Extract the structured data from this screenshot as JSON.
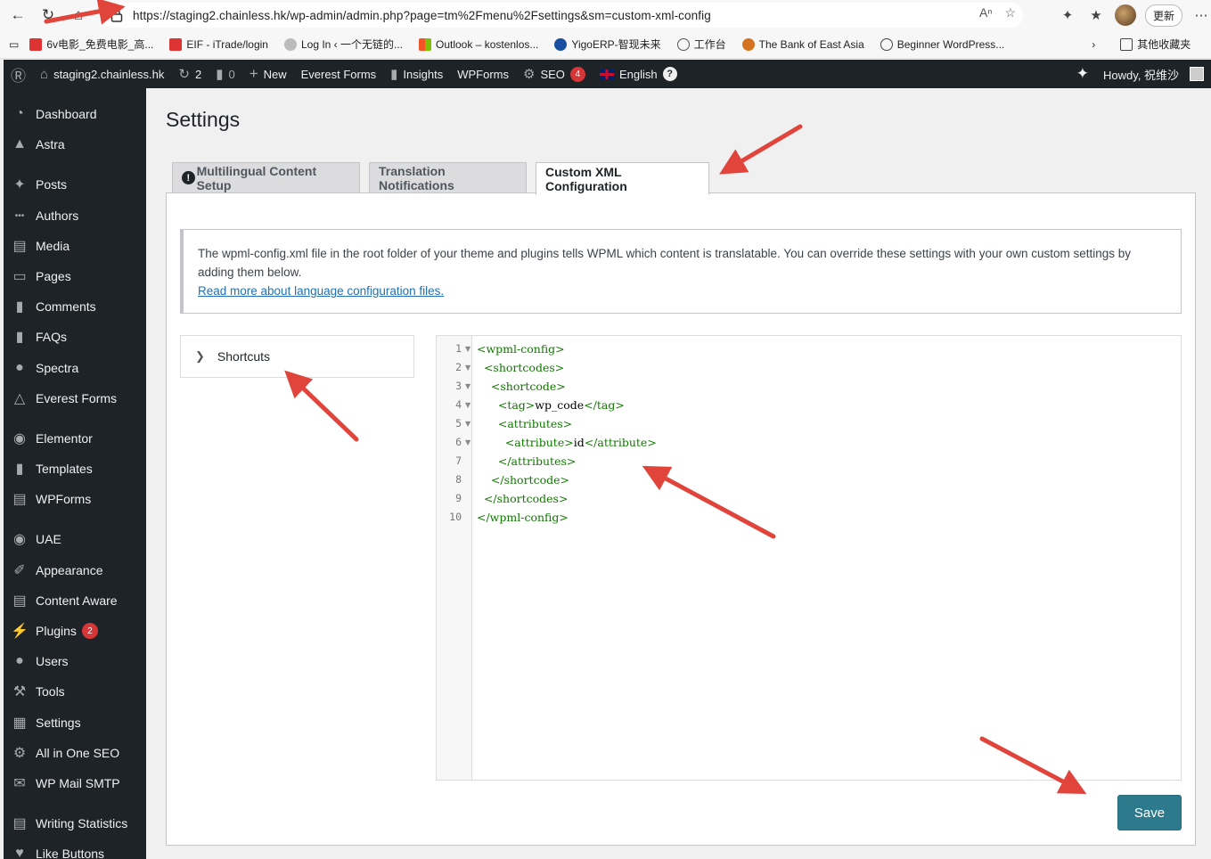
{
  "browser": {
    "url": "https://staging2.chainless.hk/wp-admin/admin.php?page=tm%2Fmenu%2Fsettings&sm=custom-xml-config",
    "update_label": "更新",
    "bookmarks": [
      {
        "label": "6v电影_免费电影_高...",
        "icon": "6v-icon",
        "color": "#d33"
      },
      {
        "label": "EIF - iTrade/login",
        "icon": "eif-icon",
        "color": "#d33"
      },
      {
        "label": "Log In ‹ 一个无链的...",
        "icon": "moon-icon",
        "color": "#888"
      },
      {
        "label": "Outlook – kostenlos...",
        "icon": "microsoft-icon",
        "color": "#f35325"
      },
      {
        "label": "YigoERP-智现未来",
        "icon": "yigo-icon",
        "color": "#1a4fa0"
      },
      {
        "label": "工作台",
        "icon": "globe-icon",
        "color": "#555"
      },
      {
        "label": "The Bank of East Asia",
        "icon": "bea-icon",
        "color": "#d4721e"
      },
      {
        "label": "Beginner WordPress...",
        "icon": "wordpress-icon",
        "color": "#444"
      }
    ],
    "other_bookmarks": "其他收藏夹"
  },
  "adminbar": {
    "site": "staging2.chainless.hk",
    "updates": "2",
    "comments": "0",
    "new": "New",
    "everest_forms": "Everest Forms",
    "insights": "Insights",
    "wpforms": "WPForms",
    "seo": "SEO",
    "seo_count": "4",
    "language": "English",
    "howdy": "Howdy, 祝维沙"
  },
  "sidebar": {
    "items": [
      {
        "label": "Dashboard",
        "icon": "dashboard-icon"
      },
      {
        "label": "Astra",
        "icon": "astra-icon"
      },
      {
        "label": "Posts",
        "icon": "pin-icon"
      },
      {
        "label": "Authors",
        "icon": "dots-icon"
      },
      {
        "label": "Media",
        "icon": "media-icon"
      },
      {
        "label": "Pages",
        "icon": "pages-icon"
      },
      {
        "label": "Comments",
        "icon": "comment-icon"
      },
      {
        "label": "FAQs",
        "icon": "faq-icon"
      },
      {
        "label": "Spectra",
        "icon": "spectra-icon"
      },
      {
        "label": "Everest Forms",
        "icon": "everest-icon"
      },
      {
        "label": "Elementor",
        "icon": "elementor-icon"
      },
      {
        "label": "Templates",
        "icon": "folder-icon"
      },
      {
        "label": "WPForms",
        "icon": "wpforms-icon"
      },
      {
        "label": "UAE",
        "icon": "uae-icon"
      },
      {
        "label": "Appearance",
        "icon": "brush-icon"
      },
      {
        "label": "Content Aware",
        "icon": "content-icon"
      },
      {
        "label": "Plugins",
        "icon": "plug-icon",
        "badge": "2"
      },
      {
        "label": "Users",
        "icon": "user-icon"
      },
      {
        "label": "Tools",
        "icon": "wrench-icon"
      },
      {
        "label": "Settings",
        "icon": "settings-icon"
      },
      {
        "label": "All in One SEO",
        "icon": "seo-icon"
      },
      {
        "label": "WP Mail SMTP",
        "icon": "mail-icon"
      },
      {
        "label": "Writing Statistics",
        "icon": "stats-icon"
      },
      {
        "label": "Like Buttons",
        "icon": "heart-icon"
      }
    ]
  },
  "main": {
    "title": "Settings",
    "tabs": [
      {
        "label": "Multilingual Content Setup"
      },
      {
        "label": "Translation Notifications"
      },
      {
        "label": "Custom XML Configuration"
      }
    ],
    "notice_text": "The wpml-config.xml file in the root folder of your theme and plugins tells WPML which content is translatable. You can override these settings with your own custom settings by adding them below.",
    "notice_link": "Read more about language configuration files.",
    "accordion_label": "Shortcuts",
    "code_lines": [
      {
        "num": "1",
        "fold": true,
        "indent": "",
        "tag": "<wpml-config>",
        "text": ""
      },
      {
        "num": "2",
        "fold": true,
        "indent": "  ",
        "tag": "<shortcodes>",
        "text": ""
      },
      {
        "num": "3",
        "fold": true,
        "indent": "    ",
        "tag": "<shortcode>",
        "text": ""
      },
      {
        "num": "4",
        "fold": true,
        "indent": "      ",
        "tag": "<tag>",
        "text": "wp_code",
        "close": "</tag>"
      },
      {
        "num": "5",
        "fold": true,
        "indent": "      ",
        "tag": "<attributes>",
        "text": ""
      },
      {
        "num": "6",
        "fold": true,
        "indent": "        ",
        "tag": "<attribute>",
        "text": "id",
        "close": "</attribute>"
      },
      {
        "num": "7",
        "fold": false,
        "indent": "      ",
        "tag": "</attributes>",
        "text": ""
      },
      {
        "num": "8",
        "fold": false,
        "indent": "    ",
        "tag": "</shortcode>",
        "text": ""
      },
      {
        "num": "9",
        "fold": false,
        "indent": "  ",
        "tag": "</shortcodes>",
        "text": ""
      },
      {
        "num": "10",
        "fold": false,
        "indent": "",
        "tag": "</wpml-config>",
        "text": ""
      }
    ],
    "save_label": "Save"
  },
  "colors": {
    "admin_dark": "#1d2327",
    "save_button": "#2e7a8d",
    "xml_tag": "#117700",
    "annotation_arrow": "#e0443a",
    "link": "#2271b1"
  }
}
